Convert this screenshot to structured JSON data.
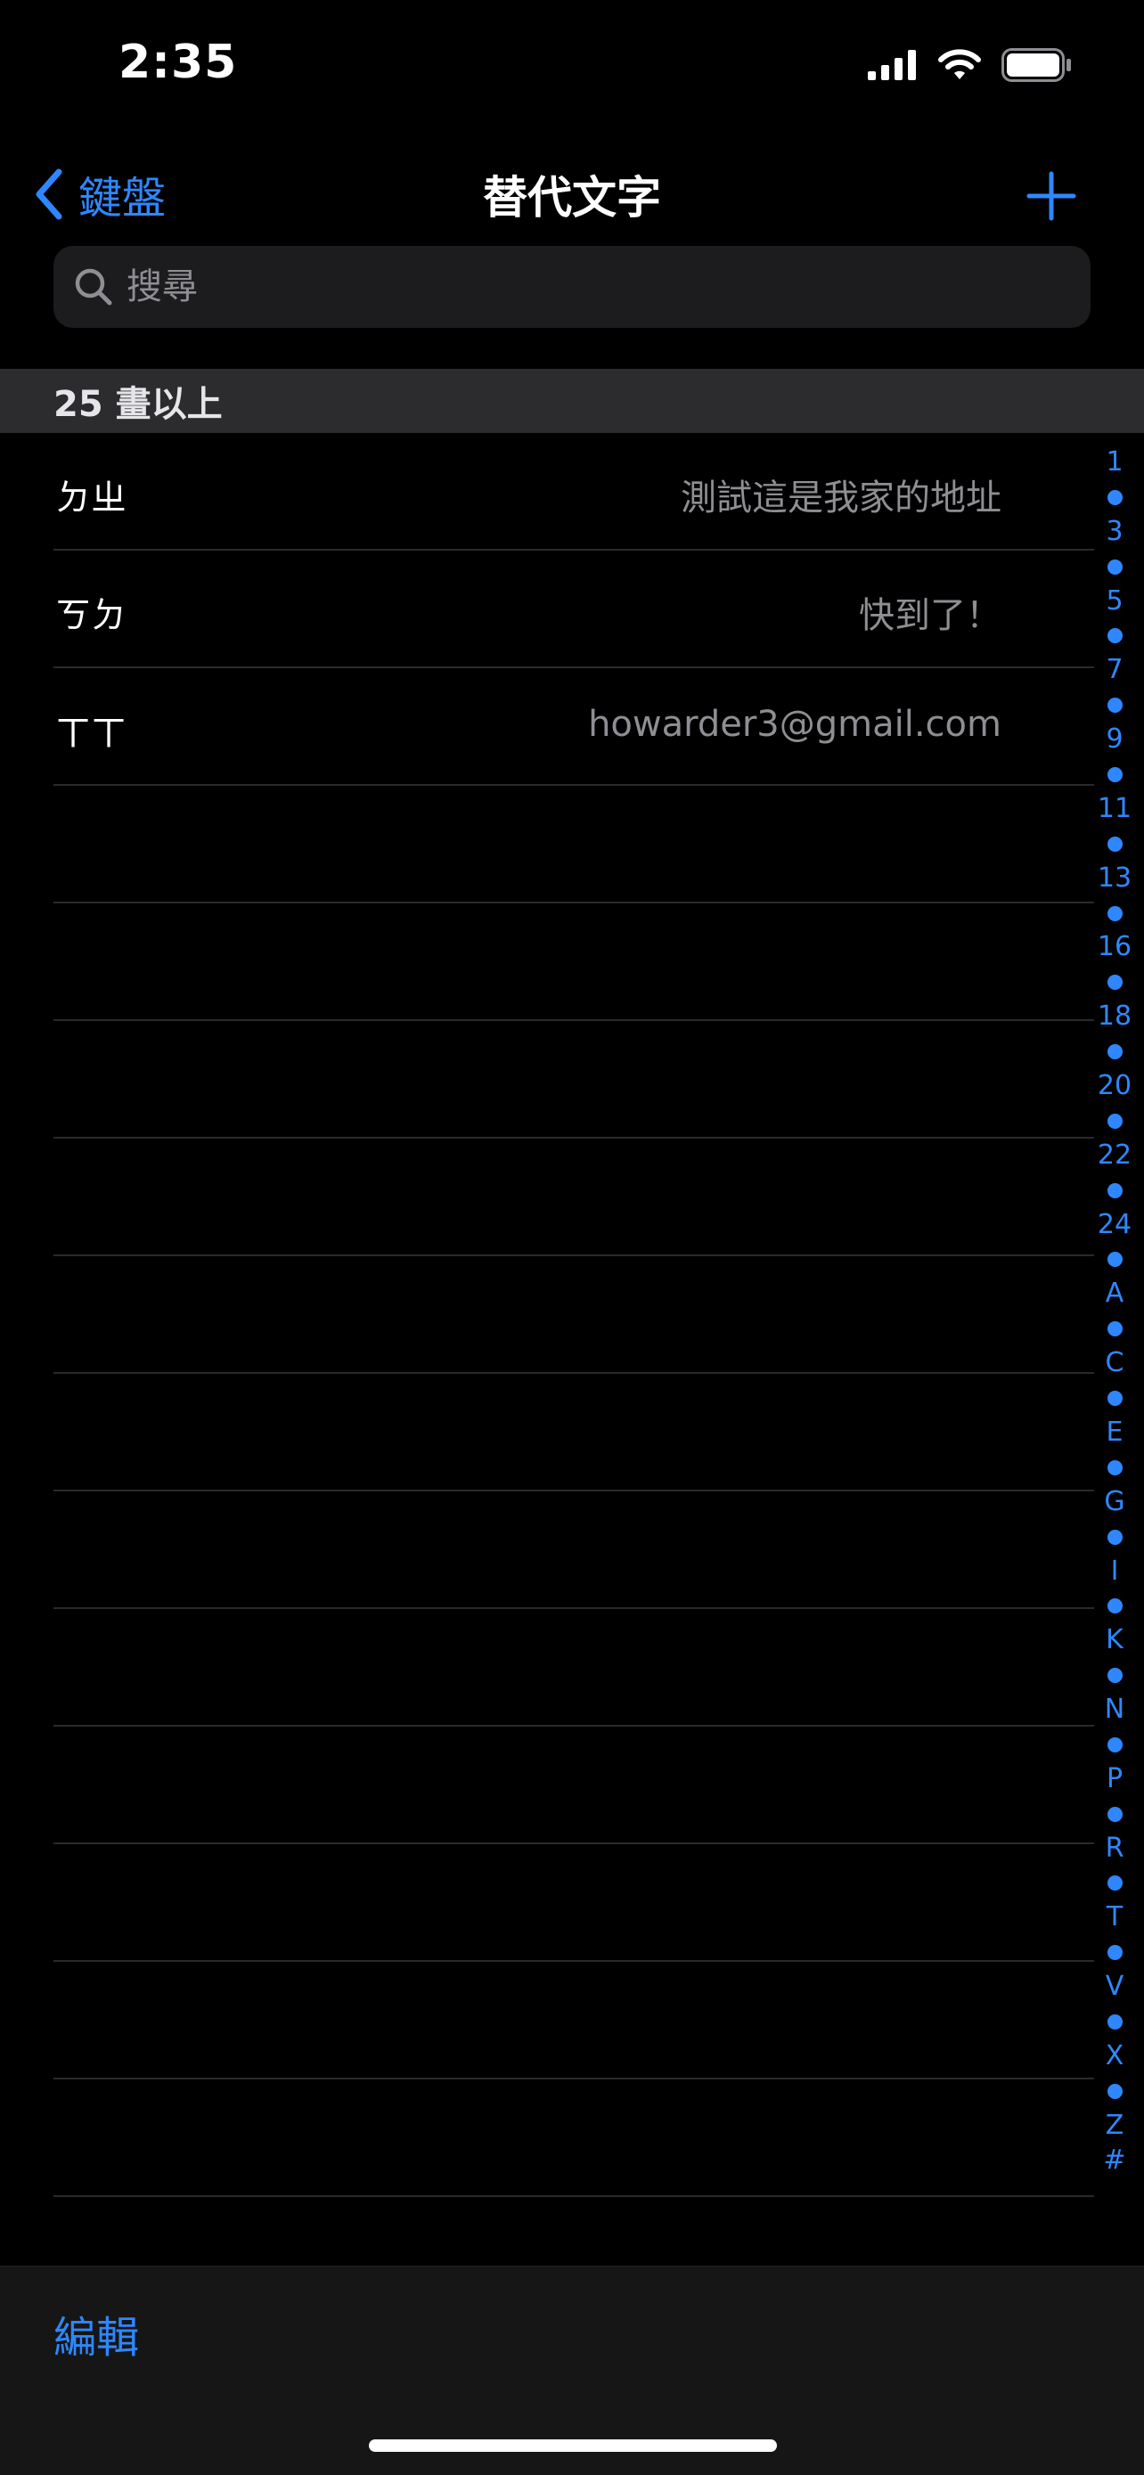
{
  "status_bar": {
    "time": "2:35",
    "icons": [
      "cellular-signal-icon",
      "wifi-icon",
      "battery-icon"
    ]
  },
  "nav": {
    "back_label": "鍵盤",
    "title": "替代文字",
    "add_icon": "plus-icon"
  },
  "search": {
    "placeholder": "搜尋"
  },
  "section": {
    "title": "25 畫以上"
  },
  "rows": [
    {
      "phrase": "ㄉㄓ",
      "shortcut": "測試這是我家的地址"
    },
    {
      "phrase": "ㄎㄉ",
      "shortcut": "快到了！"
    },
    {
      "phrase": "ㄒㄒ",
      "shortcut": "howarder3@gmail.com"
    }
  ],
  "index_bar": [
    "1",
    "•",
    "3",
    "•",
    "5",
    "•",
    "7",
    "•",
    "9",
    "•",
    "11",
    "•",
    "13",
    "•",
    "16",
    "•",
    "18",
    "•",
    "20",
    "•",
    "22",
    "•",
    "24",
    "•",
    "A",
    "•",
    "C",
    "•",
    "E",
    "•",
    "G",
    "•",
    "I",
    "•",
    "K",
    "•",
    "N",
    "•",
    "P",
    "•",
    "R",
    "•",
    "T",
    "•",
    "V",
    "•",
    "X",
    "•",
    "Z",
    "#"
  ],
  "toolbar": {
    "edit_label": "編輯"
  },
  "colors": {
    "accent": "#2f87ff",
    "background": "#000000",
    "secondary_text": "#8e8e93"
  }
}
